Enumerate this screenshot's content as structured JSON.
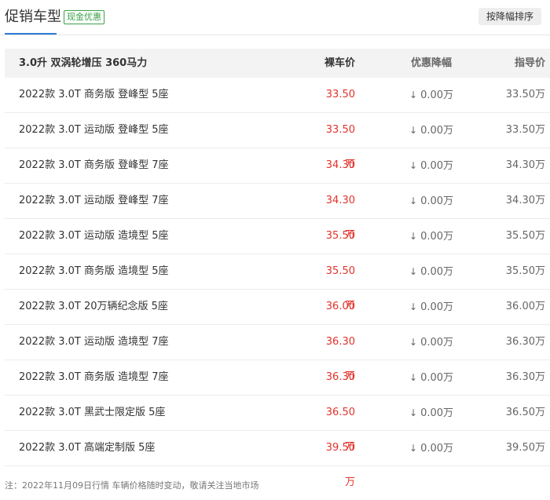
{
  "header": {
    "title": "促销车型",
    "badge": "现金优惠",
    "sort_button": "按降幅排序"
  },
  "table": {
    "columns": {
      "group": "3.0升 双涡轮增压 360马力",
      "price": "裸车价",
      "discount": "优惠降幅",
      "guide": "指导价"
    },
    "rows": [
      {
        "name": "2022款 3.0T 商务版 登峰型 5座",
        "price": "33.50万",
        "discount": "0.00万",
        "guide": "33.50万"
      },
      {
        "name": "2022款 3.0T 运动版 登峰型 5座",
        "price": "33.50万",
        "discount": "0.00万",
        "guide": "33.50万"
      },
      {
        "name": "2022款 3.0T 商务版 登峰型 7座",
        "price": "34.30万",
        "discount": "0.00万",
        "guide": "34.30万"
      },
      {
        "name": "2022款 3.0T 运动版 登峰型 7座",
        "price": "34.30万",
        "discount": "0.00万",
        "guide": "34.30万"
      },
      {
        "name": "2022款 3.0T 运动版 造境型 5座",
        "price": "35.50万",
        "discount": "0.00万",
        "guide": "35.50万"
      },
      {
        "name": "2022款 3.0T 商务版 造境型 5座",
        "price": "35.50万",
        "discount": "0.00万",
        "guide": "35.50万"
      },
      {
        "name": "2022款 3.0T 20万辆纪念版 5座",
        "price": "36.00万",
        "discount": "0.00万",
        "guide": "36.00万"
      },
      {
        "name": "2022款 3.0T 运动版 造境型 7座",
        "price": "36.30万",
        "discount": "0.00万",
        "guide": "36.30万"
      },
      {
        "name": "2022款 3.0T 商务版 造境型 7座",
        "price": "36.30万",
        "discount": "0.00万",
        "guide": "36.30万"
      },
      {
        "name": "2022款 3.0T 黑武士限定版 5座",
        "price": "36.50万",
        "discount": "0.00万",
        "guide": "36.50万"
      },
      {
        "name": "2022款 3.0T 高端定制版 5座",
        "price": "39.50万",
        "discount": "0.00万",
        "guide": "39.50万"
      }
    ]
  },
  "footer": {
    "note": "注：2022年11月09日行情 车辆价格随时变动，敬请关注当地市场"
  },
  "colors": {
    "accent_blue": "#2f7bd6",
    "badge_green": "#38a148",
    "price_red": "#e2322b"
  },
  "icons": {
    "discount_arrow": "down-arrow-icon"
  }
}
